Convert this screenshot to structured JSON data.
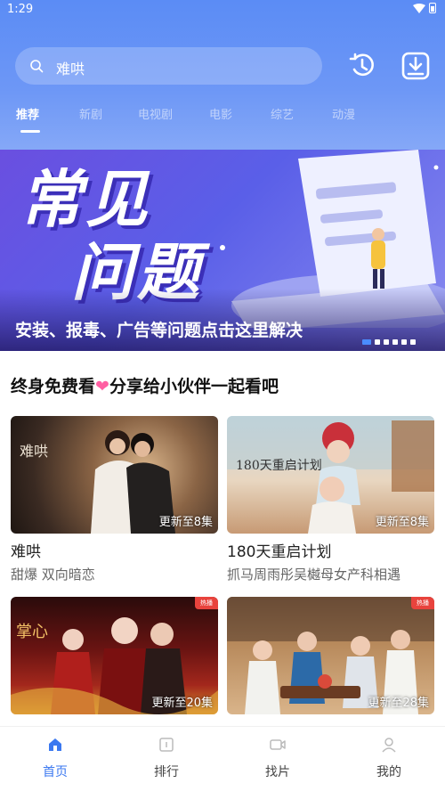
{
  "status": {
    "time": "1:29"
  },
  "search": {
    "value": "难哄"
  },
  "tabs": [
    {
      "label": "推荐"
    },
    {
      "label": "新剧"
    },
    {
      "label": "电视剧"
    },
    {
      "label": "电影"
    },
    {
      "label": "综艺"
    },
    {
      "label": "动漫"
    }
  ],
  "banner": {
    "title_line1": "常见",
    "title_line2": "问题",
    "caption": "安装、报毒、广告等问题点击这里解决",
    "page_count": 6,
    "active_page": 1
  },
  "section": {
    "title_a": "终身免费看",
    "heart": "❤",
    "title_b": "分享给小伙伴一起看吧"
  },
  "cards": [
    {
      "title": "难哄",
      "desc": "甜爆 双向暗恋",
      "update": "更新至8集",
      "hot": ""
    },
    {
      "title": "180天重启计划",
      "desc": "抓马周雨彤吴樾母女产科相遇",
      "update": "更新至8集",
      "hot": ""
    },
    {
      "title": "",
      "desc": "",
      "update": "更新至20集",
      "hot": "热播"
    },
    {
      "title": "",
      "desc": "",
      "update": "更新至28集",
      "hot": "热播"
    }
  ],
  "bottom_nav": [
    {
      "label": "首页",
      "icon": "home-icon",
      "active": true
    },
    {
      "label": "排行",
      "icon": "ranking-icon",
      "active": false
    },
    {
      "label": "找片",
      "icon": "video-icon",
      "active": false
    },
    {
      "label": "我的",
      "icon": "profile-icon",
      "active": false
    }
  ],
  "colors": {
    "header": "#5b8cf5",
    "accent": "#3b78f0",
    "heart": "#ff5fa2"
  }
}
